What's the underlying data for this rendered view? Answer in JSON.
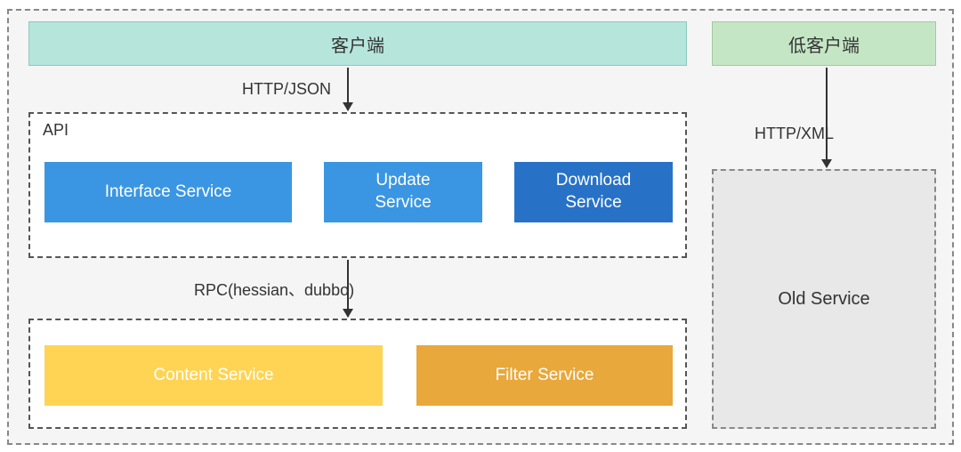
{
  "clients": {
    "main": "客户端",
    "low": "低客户端"
  },
  "labels": {
    "httpJson": "HTTP/JSON",
    "httpXml": "HTTP/XML",
    "api": "API",
    "rpc": "RPC(hessian、dubbo)"
  },
  "services": {
    "interface": "Interface Service",
    "update": "Update\nService",
    "download": "Download\nService",
    "content": "Content Service",
    "filter": "Filter Service",
    "old": "Old Service"
  }
}
